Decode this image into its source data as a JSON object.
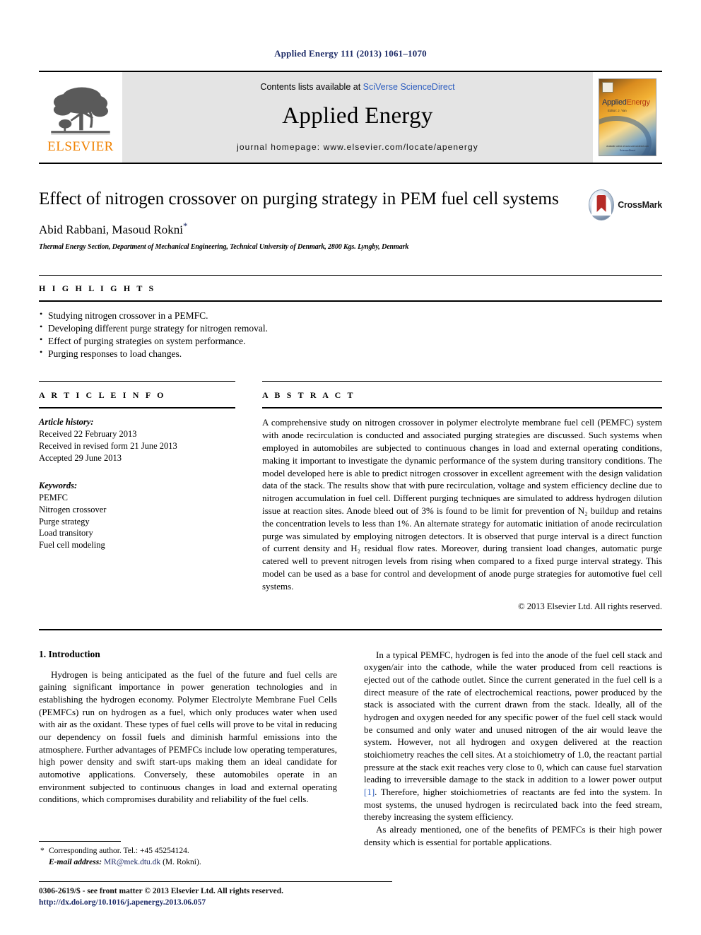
{
  "running_head": "Applied Energy 111 (2013) 1061–1070",
  "masthead": {
    "publisher_name": "ELSEVIER",
    "contents_prefix": "Contents lists available at ",
    "contents_link": "SciVerse ScienceDirect",
    "journal_title": "Applied Energy",
    "homepage_line": "journal homepage: www.elsevier.com/locate/apenergy",
    "cover": {
      "title_main": "Applied",
      "title_accent": "Energy",
      "subtitle": "Editor: J. Yan",
      "footer_top": "Available online at www.sciencedirect.com",
      "footer_bottom": "ScienceDirect"
    }
  },
  "article": {
    "title": "Effect of nitrogen crossover on purging strategy in PEM fuel cell systems",
    "authors": "Abid Rabbani, Masoud Rokni",
    "corresponding_marker": "*",
    "affiliation": "Thermal Energy Section, Department of Mechanical Engineering, Technical University of Denmark, 2800 Kgs. Lyngby, Denmark",
    "crossmark_label": "CrossMark"
  },
  "highlights": {
    "heading": "H I G H L I G H T S",
    "items": [
      "Studying nitrogen crossover in a PEMFC.",
      "Developing different purge strategy for nitrogen removal.",
      "Effect of purging strategies on system performance.",
      "Purging responses to load changes."
    ]
  },
  "article_info": {
    "heading": "A R T I C L E    I N F O",
    "history_label": "Article history:",
    "history": [
      "Received 22 February 2013",
      "Received in revised form 21 June 2013",
      "Accepted 29 June 2013"
    ],
    "keywords_label": "Keywords:",
    "keywords": [
      "PEMFC",
      "Nitrogen crossover",
      "Purge strategy",
      "Load transitory",
      "Fuel cell modeling"
    ]
  },
  "abstract": {
    "heading": "A B S T R A C T",
    "text": "A comprehensive study on nitrogen crossover in polymer electrolyte membrane fuel cell (PEMFC) system with anode recirculation is conducted and associated purging strategies are discussed. Such systems when employed in automobiles are subjected to continuous changes in load and external operating conditions, making it important to investigate the dynamic performance of the system during transitory conditions. The model developed here is able to predict nitrogen crossover in excellent agreement with the design validation data of the stack. The results show that with pure recirculation, voltage and system efficiency decline due to nitrogen accumulation in fuel cell. Different purging techniques are simulated to address hydrogen dilution issue at reaction sites. Anode bleed out of 3% is found to be limit for prevention of N₂ buildup and retains the concentration levels to less than 1%. An alternate strategy for automatic initiation of anode recirculation purge was simulated by employing nitrogen detectors. It is observed that purge interval is a direct function of current density and H₂ residual flow rates. Moreover, during transient load changes, automatic purge catered well to prevent nitrogen levels from rising when compared to a fixed purge interval strategy. This model can be used as a base for control and development of anode purge strategies for automotive fuel cell systems.",
    "copyright": "© 2013 Elsevier Ltd. All rights reserved."
  },
  "introduction": {
    "section_number_title": "1. Introduction",
    "left_paragraph": "Hydrogen is being anticipated as the fuel of the future and fuel cells are gaining significant importance in power generation technologies and in establishing the hydrogen economy. Polymer Electrolyte Membrane Fuel Cells (PEMFCs) run on hydrogen as a fuel, which only produces water when used with air as the oxidant. These types of fuel cells will prove to be vital in reducing our dependency on fossil fuels and diminish harmful emissions into the atmosphere. Further advantages of PEMFCs include low operating temperatures, high power density and swift start-ups making them an ideal candidate for automotive applications. Conversely, these automobiles operate in an environment subjected to continuous changes in load and external operating conditions, which compromises durability and reliability of the fuel cells.",
    "right_paragraph_1_before_ref": "In a typical PEMFC, hydrogen is fed into the anode of the fuel cell stack and oxygen/air into the cathode, while the water produced from cell reactions is ejected out of the cathode outlet. Since the current generated in the fuel cell is a direct measure of the rate of electrochemical reactions, power produced by the stack is associated with the current drawn from the stack. Ideally, all of the hydrogen and oxygen needed for any specific power of the fuel cell stack would be consumed and only water and unused nitrogen of the air would leave the system. However, not all hydrogen and oxygen delivered at the reaction stoichiometry reaches the cell sites. At a stoichiometry of 1.0, the reactant partial pressure at the stack exit reaches very close to 0, which can cause fuel starvation leading to irreversible damage to the stack in addition to a lower power output ",
    "right_paragraph_1_ref": "[1]",
    "right_paragraph_1_after_ref": ". Therefore, higher stoichiometries of reactants are fed into the system. In most systems, the unused hydrogen is recirculated back into the feed stream, thereby increasing the system efficiency.",
    "right_paragraph_2": "As already mentioned, one of the benefits of PEMFCs is their high power density which is essential for portable applications."
  },
  "footnote": {
    "star": "*",
    "corresponding": "Corresponding author. Tel.: +45 45254124.",
    "email_label": "E-mail address:",
    "email": "MR@mek.dtu.dk",
    "email_suffix": "(M. Rokni)."
  },
  "footer": {
    "front_matter": "0306-2619/$ - see front matter © 2013 Elsevier Ltd. All rights reserved.",
    "doi": "http://dx.doi.org/10.1016/j.apenergy.2013.06.057"
  },
  "colors": {
    "link_blue": "#2b5cbf",
    "header_blue": "#1c2a66",
    "elsevier_orange": "#F08100",
    "masthead_gray": "#e4e4e4",
    "crossmark_red": "#b52b27"
  }
}
